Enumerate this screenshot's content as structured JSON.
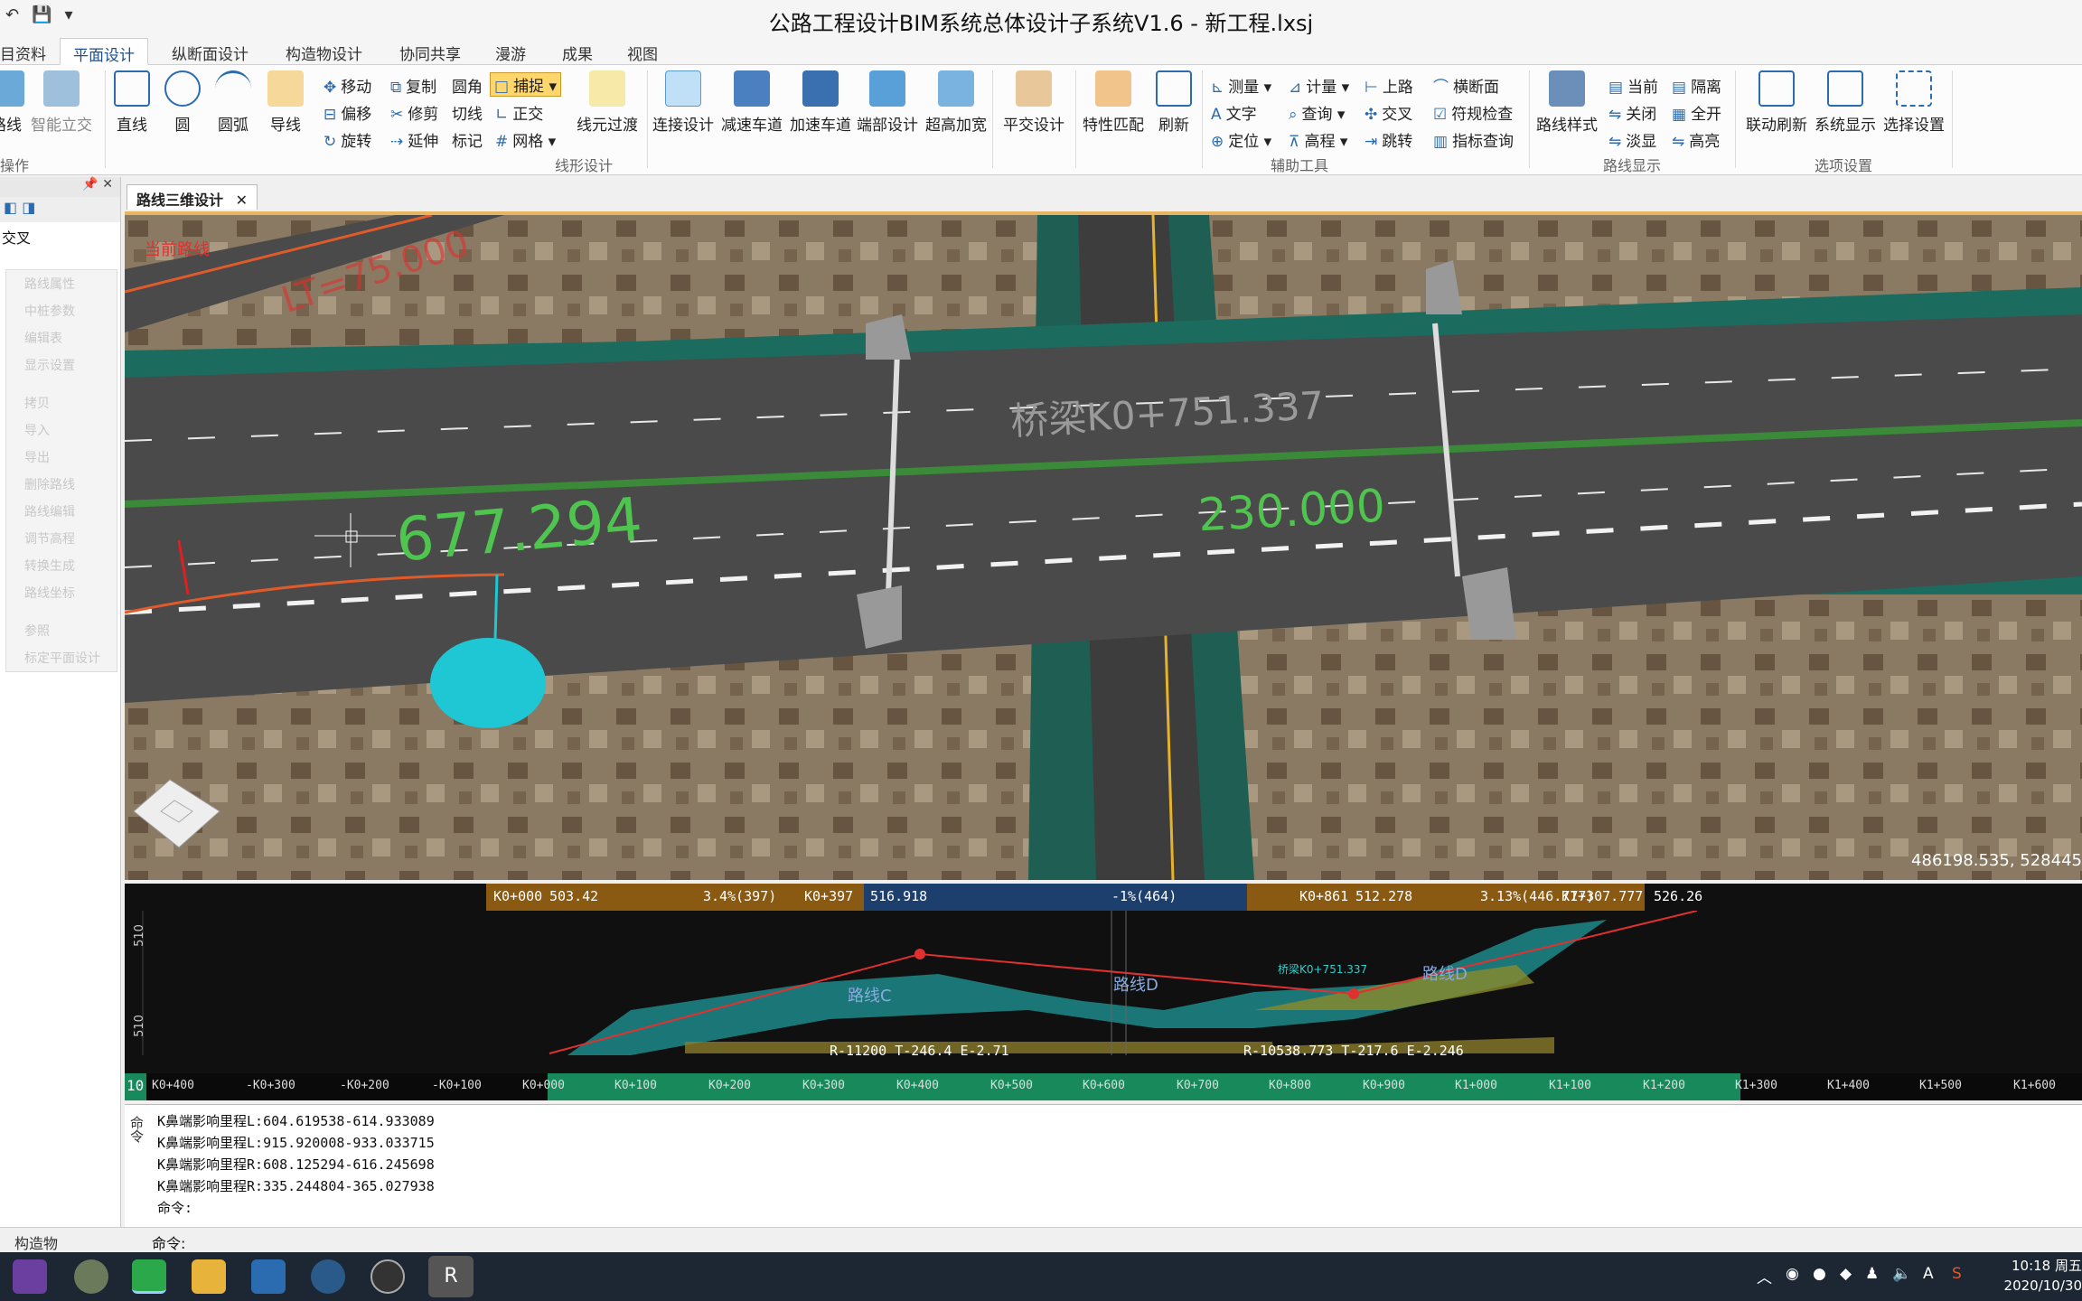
{
  "window": {
    "title": "公路工程设计BIM系统总体设计子系统V1.6 - 新工程.lxsj"
  },
  "quick_access": [
    "↶",
    "💾",
    "▾"
  ],
  "tabs": [
    {
      "label": "目资料"
    },
    {
      "label": "平面设计",
      "active": true
    },
    {
      "label": "纵断面设计"
    },
    {
      "label": "构造物设计"
    },
    {
      "label": "协同共享"
    },
    {
      "label": "漫游"
    },
    {
      "label": "成果"
    },
    {
      "label": "视图"
    }
  ],
  "ribbon": {
    "left_partial": {
      "btn1": "路线",
      "btn2": "智能立交",
      "group": "操作"
    },
    "draw": {
      "line": "直线",
      "circle": "圆",
      "arc": "圆弧",
      "guide": "导线"
    },
    "edit": {
      "move": "移动",
      "copy": "复制",
      "fillet": "圆角",
      "snap": "捕捉",
      "offset": "偏移",
      "trim": "修剪",
      "tangent": "切线",
      "ortho": "正交",
      "rotate": "旋转",
      "extend": "延伸",
      "mark": "标记",
      "grid": "网格"
    },
    "transition": {
      "label": "线元过渡",
      "group": "线形设计"
    },
    "connect": {
      "c1": "连接设计",
      "c2": "减速车道",
      "c3": "加速车道",
      "c4": "端部设计",
      "c5": "超高加宽",
      "c6": "平交设计"
    },
    "match": {
      "m1": "特性匹配",
      "m2": "刷新"
    },
    "aux": {
      "measure": "测量",
      "calc": "计量",
      "upper": "上路",
      "cross": "横断面",
      "text": "文字",
      "query": "查询",
      "intersect": "交叉",
      "check": "符规检查",
      "locate": "定位",
      "elev": "高程",
      "jump": "跳转",
      "indicator": "指标查询",
      "group": "辅助工具"
    },
    "display": {
      "style": "路线样式",
      "current": "当前",
      "isolate": "隔离",
      "close": "关闭",
      "all_on": "全开",
      "fade": "淡显",
      "highlight": "高亮",
      "group": "路线显示"
    },
    "options": {
      "o1": "联动刷新",
      "o2": "系统显示",
      "o3": "选择设置",
      "group": "选项设置"
    }
  },
  "left_panel": {
    "header": "📌 ✕",
    "selected": "交叉",
    "items": [
      "路线属性",
      "中桩参数",
      "编辑表",
      "显示设置",
      "拷贝",
      "导入",
      "导出",
      "删除路线",
      "路线编辑",
      "调节高程",
      "转换生成",
      "路线坐标",
      "参照",
      "标定平面设计"
    ]
  },
  "document_tab": {
    "label": "路线三维设计",
    "close": "✕"
  },
  "viewport": {
    "current_route": "当前路线",
    "bridge_label": "桥梁K0+751.337",
    "measure1": "677.294",
    "measure2": "230.000",
    "line_tag": "LT=75.000",
    "coords": "486198.535, 528445"
  },
  "profile": {
    "header": [
      {
        "text": "K0+000"
      },
      {
        "text": "503.42"
      },
      {
        "text": "3.4%(397)"
      },
      {
        "text": "K0+397"
      },
      {
        "text": "516.918"
      },
      {
        "text": "-1%(464)"
      },
      {
        "text": "K0+861"
      },
      {
        "text": "512.278"
      },
      {
        "text": "3.13%(446.777)"
      },
      {
        "text": "K1+307.777"
      },
      {
        "text": "526.26"
      }
    ],
    "y_labels": [
      "510",
      "510"
    ],
    "curve1": "R-11200 T-246.4 E-2.71",
    "curve2": "R-10538.773 T-217.6 E-2.246",
    "route_labels": [
      "路线C",
      "路线D",
      "路线D"
    ],
    "bridge_note": "桥梁K0+751.337",
    "scale": "10",
    "x_ticks": [
      "K0+400",
      "-K0+300",
      "-K0+200",
      "-K0+100",
      "K0+000",
      "K0+100",
      "K0+200",
      "K0+300",
      "K0+400",
      "K0+500",
      "K0+600",
      "K0+700",
      "K0+800",
      "K0+900",
      "K1+000",
      "K1+100",
      "K1+200",
      "K1+300",
      "K1+400",
      "K1+500",
      "K1+600"
    ]
  },
  "command": {
    "side_label": "命令",
    "lines": [
      "K鼻端影响里程L:604.619538-614.933089",
      "K鼻端影响里程L:915.920008-933.033715",
      "K鼻端影响里程R:608.125294-616.245698",
      "K鼻端影响里程R:335.244804-365.027938",
      "命令:"
    ],
    "prompt": "命令:"
  },
  "statusbar": {
    "left": "构造物"
  },
  "taskbar": {
    "clock_time": "10:18 周五",
    "clock_date": "2020/10/30",
    "ime": "A"
  }
}
